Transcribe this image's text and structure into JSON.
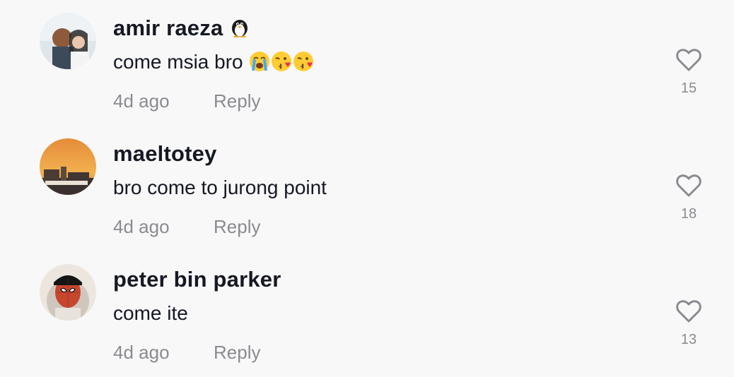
{
  "comments": [
    {
      "username": "amir raeza",
      "username_badge_icon": "penguin-icon",
      "text": "come msia bro",
      "text_emojis": [
        "loudly-crying-face-emoji",
        "face-blowing-kiss-emoji",
        "face-blowing-kiss-emoji"
      ],
      "time": "4d ago",
      "reply_label": "Reply",
      "likes": "15"
    },
    {
      "username": "maeltotey",
      "text": "bro come to jurong point",
      "time": "4d ago",
      "reply_label": "Reply",
      "likes": "18"
    },
    {
      "username": "peter bin parker",
      "text": "come ite",
      "time": "4d ago",
      "reply_label": "Reply",
      "likes": "13"
    }
  ],
  "colors": {
    "background": "#f8f8f8",
    "primary_text": "#161823",
    "secondary_text": "#8a8b91"
  }
}
